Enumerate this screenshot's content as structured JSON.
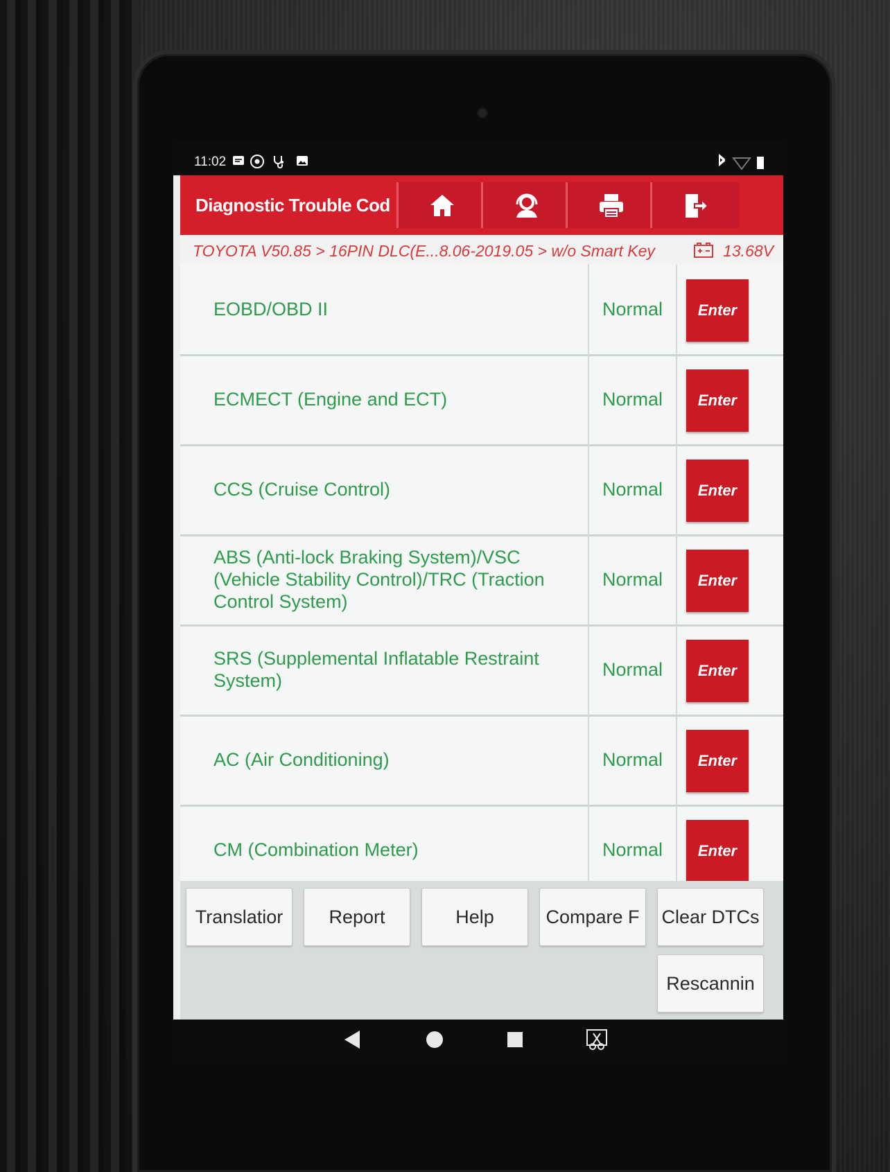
{
  "status_bar": {
    "time": "11:02"
  },
  "header": {
    "title": "Diagnostic Trouble Cod"
  },
  "breadcrumb": {
    "path": "TOYOTA V50.85 > 16PIN DLC(E...8.06-2019.05 > w/o Smart Key",
    "voltage": "13.68V"
  },
  "systems": [
    {
      "name": "EOBD/OBD II",
      "status": "Normal",
      "action": "Enter"
    },
    {
      "name": "ECMECT (Engine and ECT)",
      "status": "Normal",
      "action": "Enter"
    },
    {
      "name": "CCS (Cruise Control)",
      "status": "Normal",
      "action": "Enter"
    },
    {
      "name": "ABS (Anti-lock Braking System)/VSC (Vehicle Stability Control)/TRC (Traction Control System)",
      "status": "Normal",
      "action": "Enter"
    },
    {
      "name": "SRS (Supplemental Inflatable Restraint System)",
      "status": "Normal",
      "action": "Enter"
    },
    {
      "name": "AC (Air Conditioning)",
      "status": "Normal",
      "action": "Enter"
    },
    {
      "name": "CM (Combination Meter)",
      "status": "Normal",
      "action": "Enter"
    }
  ],
  "toolbar": {
    "translation": "Translatior",
    "report": "Report",
    "help": "Help",
    "compare": "Compare F",
    "clear_dtcs": "Clear DTCs",
    "rescanning": "Rescannin"
  },
  "colors": {
    "header_red": "#d41f2a",
    "enter_red": "#cc1a24",
    "status_green": "#2e9b4c",
    "breadcrumb_red": "#d63a3a"
  }
}
